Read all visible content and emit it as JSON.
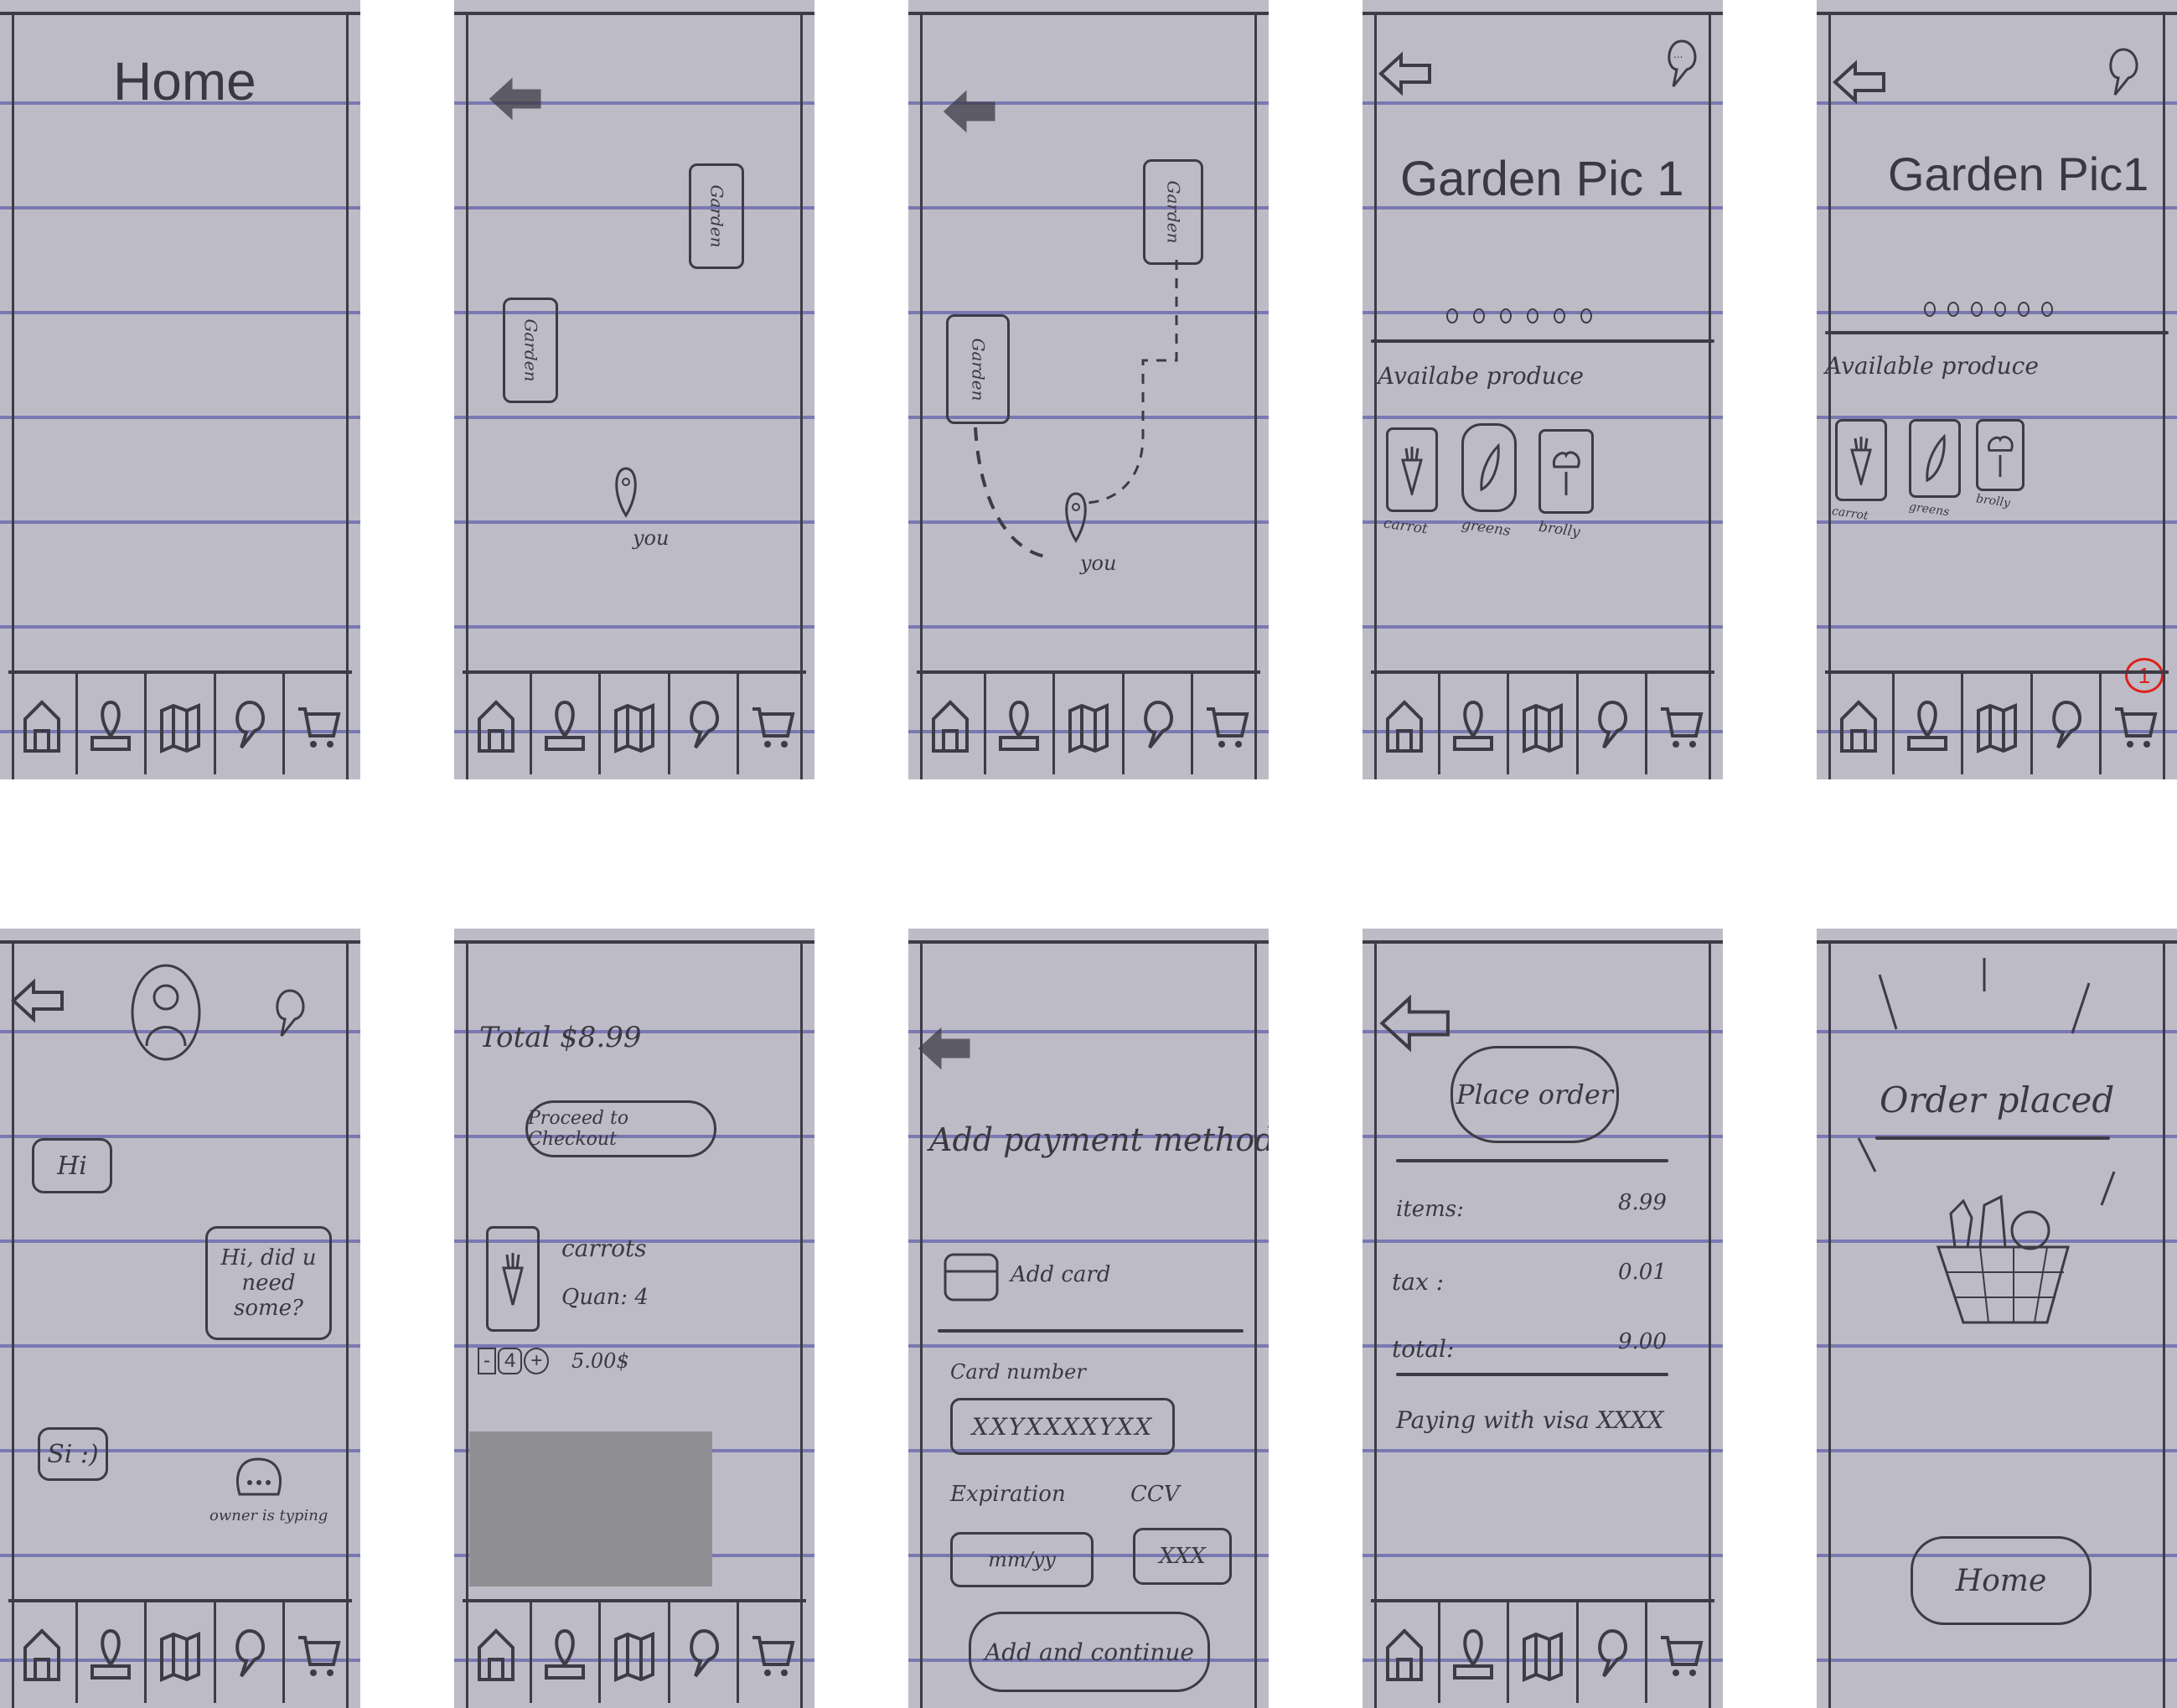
{
  "colors": {
    "paper": "#bdbcc6",
    "rule": "#7a78b2",
    "ink": "#3d3b45",
    "badge": "#e0201c",
    "redacted": "#8f8e93"
  },
  "nav_icons": [
    "home-icon",
    "map-pin-icon",
    "garden-map-icon",
    "chat-icon",
    "cart-icon"
  ],
  "screen1": {
    "title": "Home"
  },
  "screen2": {
    "garden_a": "Garden",
    "garden_b": "Garden",
    "pin_label": "you"
  },
  "screen3": {
    "garden_a": "Garden",
    "garden_b": "Garden",
    "pin_label": "you"
  },
  "screen4": {
    "title": "Garden Pic 1",
    "section": "Availabe produce",
    "produce": [
      "carrot",
      "greens",
      "brolly"
    ]
  },
  "screen5": {
    "title": "Garden Pic1",
    "section": "Available produce",
    "produce": [
      "carrot",
      "greens",
      "brolly"
    ],
    "cart_badge": "1"
  },
  "screen6": {
    "msg1": "Hi",
    "msg2": "Hi, did u need some?",
    "msg3": "Si :)",
    "typing": "owner is typing"
  },
  "screen7": {
    "total": "Total $8.99",
    "checkout": "Proceed to Checkout",
    "item_name": "carrots",
    "item_qty": "Quan: 4",
    "stepper_minus": "-",
    "stepper_value": "4",
    "stepper_plus": "+",
    "item_price": "5.00$"
  },
  "screen8": {
    "title": "Add payment method",
    "add_card": "Add card",
    "card_number_label": "Card number",
    "card_number_value": "XXYXXXXYXX",
    "expiration_label": "Expiration",
    "expiration_value": "mm/yy",
    "ccv_label": "CCV",
    "ccv_value": "XXX",
    "continue": "Add and continue"
  },
  "screen9": {
    "place_order": "Place order",
    "items_label": "items:",
    "items_value": "8.99",
    "tax_label": "tax :",
    "tax_value": "0.01",
    "total_label": "total:",
    "total_value": "9.00",
    "paying": "Paying with visa XXXX"
  },
  "screen10": {
    "title": "Order placed",
    "home": "Home"
  }
}
